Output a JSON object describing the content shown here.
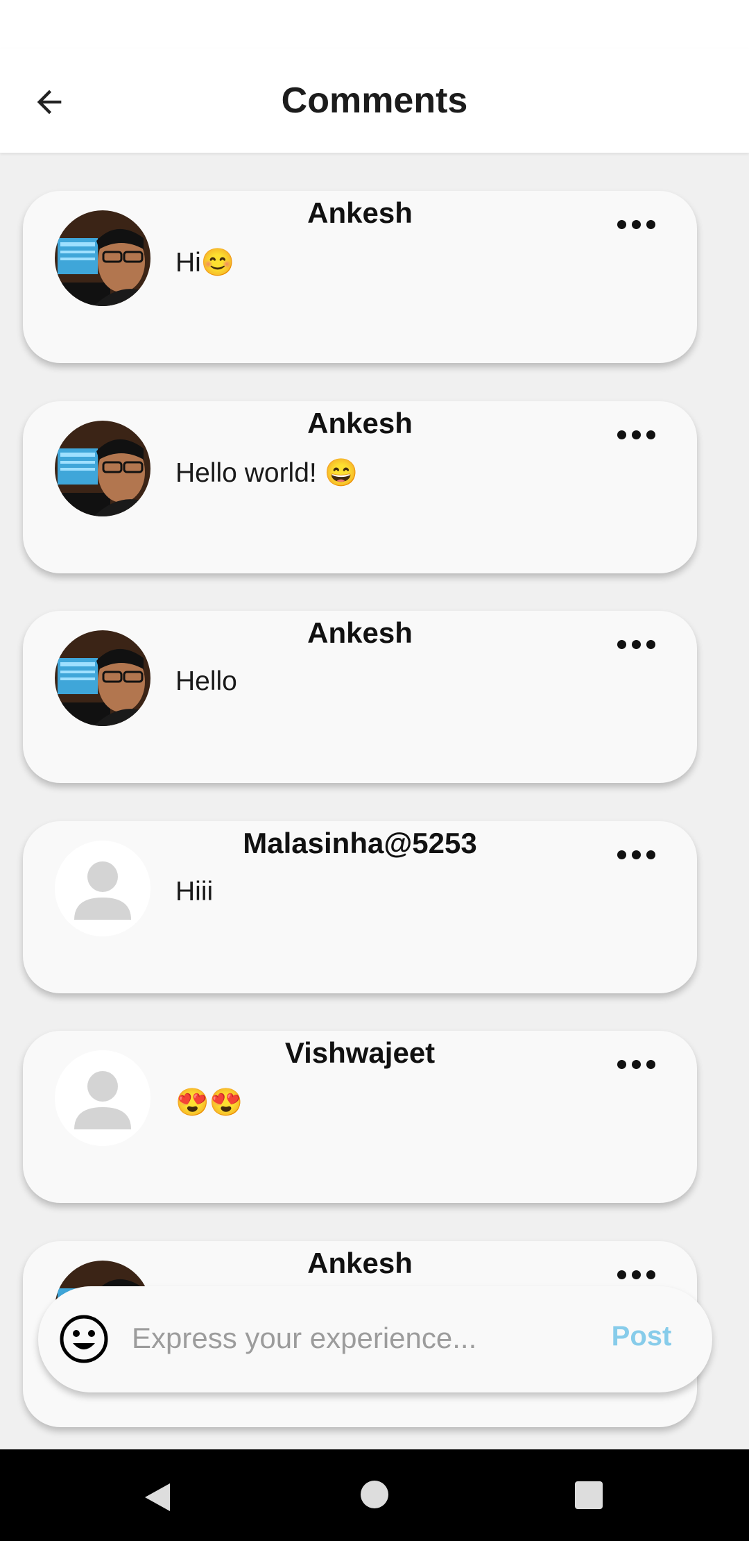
{
  "header": {
    "title": "Comments",
    "back_icon": "arrow-left-icon"
  },
  "comments": [
    {
      "author": "Ankesh",
      "text": "Hi😊",
      "avatar": "photo"
    },
    {
      "author": "Ankesh",
      "text": "Hello world! 😄",
      "avatar": "photo"
    },
    {
      "author": "Ankesh",
      "text": "Hello",
      "avatar": "photo"
    },
    {
      "author": "Malasinha@5253",
      "text": "Hiii",
      "avatar": "placeholder"
    },
    {
      "author": "Vishwajeet",
      "text": "😍😍",
      "avatar": "placeholder"
    },
    {
      "author": "Ankesh",
      "text": "",
      "avatar": "photo"
    }
  ],
  "composer": {
    "placeholder": "Express your experience...",
    "post_label": "Post",
    "emoji_icon": "smiley-icon"
  },
  "colors": {
    "accent": "#87ccea",
    "card": "#f9f9f9",
    "background": "#f0f0f0"
  }
}
